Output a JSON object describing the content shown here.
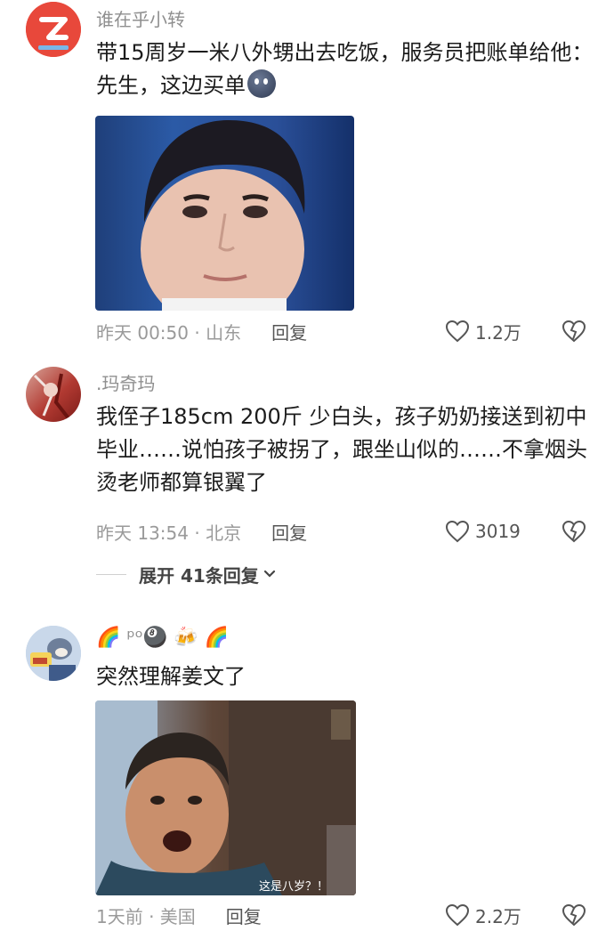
{
  "comments": [
    {
      "username": "谁在乎小转",
      "text": "带15周岁一米八外甥出去吃饭，服务员把账单给他：先生，这边买单",
      "time_location": "昨天 00:50 · 山东",
      "reply_label": "回复",
      "likes": "1.2万",
      "has_image": true
    },
    {
      "username": ".玛奇玛",
      "text": "我侄子185cm 200斤 少白头，孩子奶奶接送到初中毕业……说怕孩子被拐了，跟坐山似的……不拿烟头烫老师都算银翼了",
      "time_location": "昨天 13:54 · 北京",
      "reply_label": "回复",
      "likes": "3019",
      "expand_label": "展开 41条回复"
    },
    {
      "username": "🌈 ᵖᵒ🎱 🍻 🌈",
      "text": "突然理解姜文了",
      "time_location": "1天前 · 美国",
      "reply_label": "回复",
      "likes": "2.2万",
      "has_image": true,
      "image_caption": "这是八岁？！"
    }
  ],
  "colors": {
    "meta": "#9a9a9a",
    "username": "#8f8f8f",
    "zhihu_avatar": "#e8483b"
  }
}
